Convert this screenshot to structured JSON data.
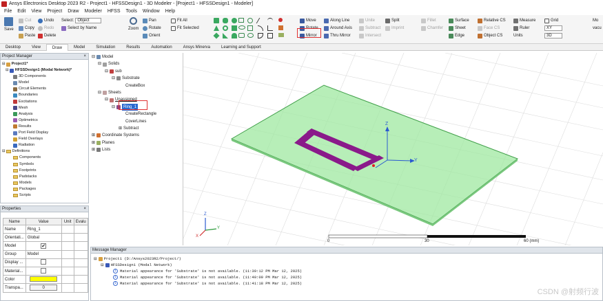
{
  "title": "Ansys Electronics Desktop 2023 R2 - Project1 - HFSSDesign1 - 3D Modeler - [Project1 - HFSSDesign1 - Modeler]",
  "menu": [
    "File",
    "Edit",
    "View",
    "Project",
    "Draw",
    "Modeler",
    "HFSS",
    "Tools",
    "Window",
    "Help"
  ],
  "ribbon": {
    "save": "Save",
    "cut": "Cut",
    "copy": "Copy",
    "paste": "Paste",
    "undo": "Undo",
    "redo": "Redo",
    "delete": "Delete",
    "select_label": "Select:",
    "select_value": "Object",
    "select_by_name": "Select by Name",
    "zoom": "Zoom",
    "pan": "Pan",
    "rotate_view": "Rotate",
    "orient": "Orient",
    "fit_all": "Fit All",
    "fit_selected": "Fit Selected",
    "move": "Move",
    "rotate": "Rotate",
    "mirror": "Mirror",
    "along_line": "Along Line",
    "around_axis": "Around Axis",
    "thru_mirror": "Thru Mirror",
    "unite": "Unite",
    "subtract": "Subtract",
    "intersect": "Intersect",
    "split": "Split",
    "imprint": "Imprint",
    "fillet": "Fillet",
    "chamfer": "Chamfer",
    "surface": "Surface",
    "sheet": "Sheet",
    "edge": "Edge",
    "relative_cs": "Relative CS",
    "face_cs": "Face CS",
    "object_cs": "Object CS",
    "measure": "Measure",
    "ruler": "Ruler",
    "units": "Units",
    "grid": "Grid",
    "plane_value": "XY",
    "dim_value": "3D",
    "material_label": "Mo",
    "material_value": "vacu"
  },
  "tabs": [
    "Desktop",
    "View",
    "Draw",
    "Model",
    "Simulation",
    "Results",
    "Automation",
    "Ansys Minerva",
    "Learning and Support"
  ],
  "active_tab": "Draw",
  "project_manager": {
    "header": "Project Manager",
    "project": "Project1*",
    "design": "HFSSDesign1 (Modal Network)*",
    "items": [
      "3D Components",
      "Model",
      "Circuit Elements",
      "Boundaries",
      "Excitations",
      "Mesh",
      "Analysis",
      "Optimetrics",
      "Results",
      "Port Field Display",
      "Field Overlays",
      "Radiation"
    ],
    "definitions": "Definitions",
    "def_items": [
      "Components",
      "Symbols",
      "Footprints",
      "Padstacks",
      "Models",
      "Packages",
      "Scripts"
    ]
  },
  "properties": {
    "header": "Properties",
    "cols": [
      "Name",
      "Value",
      "Unit",
      "Evalu"
    ],
    "rows": [
      {
        "name": "Name",
        "value": "Ring_1"
      },
      {
        "name": "Orientati...",
        "value": "Global"
      },
      {
        "name": "Model",
        "value": "✔"
      },
      {
        "name": "Group",
        "value": "Model"
      },
      {
        "name": "Display ...",
        "value": ""
      },
      {
        "name": "Material...",
        "value": ""
      },
      {
        "name": "Color",
        "value": ""
      },
      {
        "name": "Transpa...",
        "value": "0"
      }
    ],
    "color_value": "#ffff00"
  },
  "model_tree": {
    "model": "Model",
    "solids": "Solids",
    "sub": "sub",
    "substrate": "Substrate",
    "create_box": "CreateBox",
    "sheets": "Sheets",
    "unassigned": "Unassigned",
    "ring": "Ring_1",
    "create_rectangle": "CreateRectangle",
    "cover_lines": "CoverLines",
    "subtract": "Subtract",
    "coord_systems": "Coordinate Systems",
    "planes": "Planes",
    "lists": "Lists"
  },
  "viewport": {
    "scale_ticks": [
      "0",
      "30",
      "60 (mm)"
    ],
    "axis_z": "Z",
    "axis_y": "Y",
    "axis_x": "X"
  },
  "messages": {
    "header": "Message Manager",
    "project_line": "Project1 (D:/Ansys2023R2/Project/)",
    "design_line": "HFSSDesign1 (Modal Network)",
    "lines": [
      "Material appearance for 'Substrate' is not available.  (11:39:12 PM  Mar 12, 2025)",
      "Material appearance for 'Substrate' is not available.  (11:40:09 PM  Mar 12, 2025)",
      "Material appearance for 'Substrate' is not available.  (11:41:18 PM  Mar 12, 2025)"
    ]
  },
  "watermark": "CSDN @射频行波"
}
